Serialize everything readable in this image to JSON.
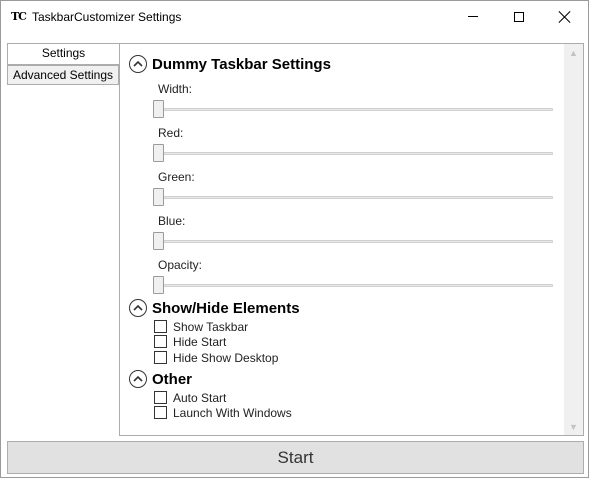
{
  "window": {
    "icon_text": "TC",
    "title": "TaskbarCustomizer Settings"
  },
  "tabs": [
    {
      "label": "Settings",
      "selected": true
    },
    {
      "label": "Advanced Settings",
      "selected": false
    }
  ],
  "sections": {
    "dummy": {
      "title": "Dummy Taskbar Settings",
      "sliders": [
        {
          "label": "Width:",
          "value_fraction": 0
        },
        {
          "label": "Red:",
          "value_fraction": 0
        },
        {
          "label": "Green:",
          "value_fraction": 0
        },
        {
          "label": "Blue:",
          "value_fraction": 0
        },
        {
          "label": "Opacity:",
          "value_fraction": 0
        }
      ]
    },
    "showhide": {
      "title": "Show/Hide Elements",
      "checkboxes": [
        {
          "label": "Show Taskbar",
          "checked": false
        },
        {
          "label": "Hide Start",
          "checked": false
        },
        {
          "label": "Hide Show Desktop",
          "checked": false
        }
      ]
    },
    "other": {
      "title": "Other",
      "checkboxes": [
        {
          "label": "Auto Start",
          "checked": false
        },
        {
          "label": "Launch With Windows",
          "checked": false
        }
      ]
    }
  },
  "start_button": {
    "label": "Start"
  }
}
